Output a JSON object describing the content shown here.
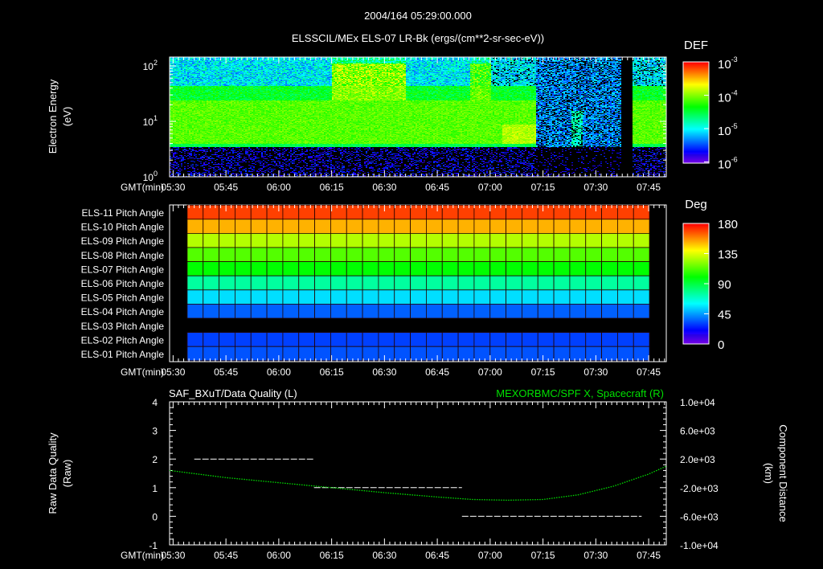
{
  "header": {
    "datetime": "2004/164 05:29:00.000"
  },
  "time_axis": {
    "label": "GMT(min)",
    "ticks": [
      "05:30",
      "05:45",
      "06:00",
      "06:15",
      "06:30",
      "06:45",
      "07:00",
      "07:15",
      "07:30",
      "07:45"
    ],
    "range": [
      "05:29",
      "07:50"
    ]
  },
  "chart_data": [
    {
      "type": "heatmap",
      "title": "ELSSCIL/MEx ELS-07 LR-Bk  (ergs/(cm**2-sr-sec-eV))",
      "ylabel": [
        "Electron Energy",
        "(eV)"
      ],
      "xlabel": "GMT(min)",
      "yscale": "log",
      "ylim": [
        1,
        140
      ],
      "yticks": [
        {
          "base": "10",
          "exp": "2",
          "value": 100
        },
        {
          "base": "10",
          "exp": "1",
          "value": 10
        },
        {
          "base": "10",
          "exp": "0",
          "value": 1
        }
      ],
      "colorbar": {
        "label": "DEF",
        "scale": "log",
        "range": [
          1e-06,
          0.001
        ],
        "ticks": [
          {
            "base": "10",
            "exp": "-3"
          },
          {
            "base": "10",
            "exp": "-4"
          },
          {
            "base": "10",
            "exp": "-5"
          },
          {
            "base": "10",
            "exp": "-6"
          }
        ]
      },
      "description_features": {
        "main_band_eV": [
          3.5,
          25
        ],
        "main_band_log_def": -4.3,
        "enhancement_intervals": [
          [
            "06:15",
            "06:35"
          ],
          [
            "06:54",
            "07:00"
          ]
        ],
        "low_flux_interval": [
          "07:13",
          "07:37"
        ],
        "gap_interval": [
          "07:37",
          "07:40"
        ]
      }
    },
    {
      "type": "heatmap",
      "xlabel": "GMT(min)",
      "rows": [
        {
          "label": "ELS-11 Pitch Angle",
          "value": 170
        },
        {
          "label": "ELS-10 Pitch Angle",
          "value": 152
        },
        {
          "label": "ELS-09 Pitch Angle",
          "value": 128
        },
        {
          "label": "ELS-08 Pitch Angle",
          "value": 113
        },
        {
          "label": "ELS-07 Pitch Angle",
          "value": 100
        },
        {
          "label": "ELS-06 Pitch Angle",
          "value": 75
        },
        {
          "label": "ELS-05 Pitch Angle",
          "value": 55
        },
        {
          "label": "ELS-04 Pitch Angle",
          "value": 35
        },
        {
          "label": "ELS-03 Pitch Angle",
          "value": null
        },
        {
          "label": "ELS-02 Pitch Angle",
          "value": 30
        },
        {
          "label": "ELS-01 Pitch Angle",
          "value": 33
        }
      ],
      "time_range": [
        "05:34",
        "07:45"
      ],
      "colorbar": {
        "label": "Deg",
        "range": [
          0,
          180
        ],
        "ticks": [
          "180",
          "135",
          "90",
          "45",
          "0"
        ]
      }
    },
    {
      "type": "line",
      "title_left": "SAF_BXuT/Data Quality (L)",
      "title_right": "MEXORBMC/SPF X, Spacecraft (R)",
      "ylabel_left": [
        "Raw Data Quality",
        "(Raw)"
      ],
      "ylabel_right": [
        "Component Distance",
        "(km)"
      ],
      "ylim_left": [
        -1,
        4
      ],
      "ylim_right": [
        -10000,
        10000
      ],
      "yticks_left": [
        "4",
        "3",
        "2",
        "1",
        "0",
        "-1"
      ],
      "yticks_right": [
        "1.0e+04",
        "6.0e+03",
        "2.0e+03",
        "-2.0e+03",
        "-6.0e+03",
        "-1.0e+04"
      ],
      "colors": {
        "left": "#ffffff",
        "right": "#00e000"
      },
      "series": [
        {
          "name": "Data Quality",
          "axis": "left",
          "segments": [
            {
              "from": "05:36",
              "to": "06:10",
              "value": 2
            },
            {
              "from": "06:10",
              "to": "06:52",
              "value": 1
            },
            {
              "from": "06:52",
              "to": "07:43",
              "value": 0
            }
          ]
        },
        {
          "name": "Spacecraft X (km)",
          "axis": "right",
          "x": [
            "05:29",
            "05:45",
            "06:00",
            "06:15",
            "06:30",
            "06:45",
            "06:55",
            "07:05",
            "07:15",
            "07:25",
            "07:35",
            "07:45",
            "07:50"
          ],
          "y": [
            400,
            -600,
            -1300,
            -2000,
            -2700,
            -3300,
            -3650,
            -3750,
            -3650,
            -3000,
            -1800,
            -100,
            1000
          ]
        }
      ]
    }
  ]
}
